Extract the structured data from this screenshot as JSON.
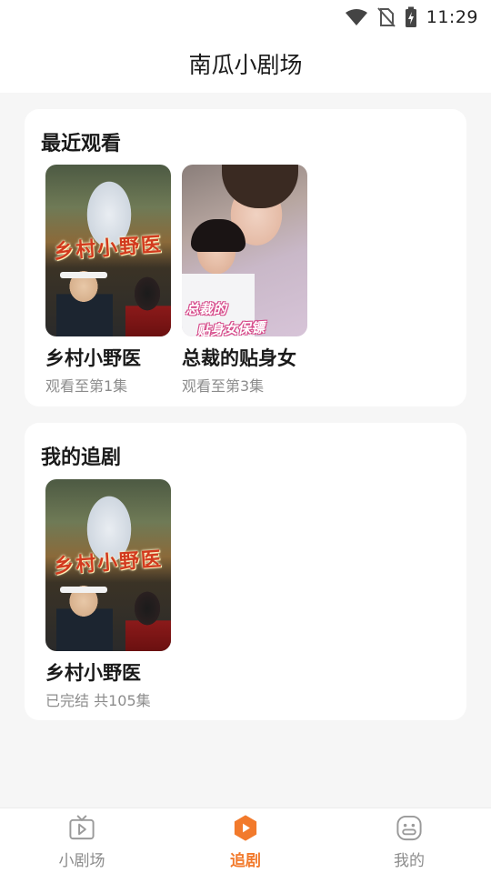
{
  "status_bar": {
    "time": "11:29",
    "icons": [
      "wifi-icon",
      "no-sim-icon",
      "battery-charging-icon"
    ]
  },
  "header": {
    "title": "南瓜小剧场"
  },
  "recent": {
    "title": "最近观看",
    "items": [
      {
        "name": "乡村小野医",
        "progress": "观看至第1集",
        "poster_text": "乡村小野医"
      },
      {
        "name": "总裁的贴身女",
        "progress": "观看至第3集",
        "poster_text_line1": "总裁的",
        "poster_text_line2": "贴身女保镖"
      }
    ]
  },
  "following": {
    "title": "我的追剧",
    "items": [
      {
        "name": "乡村小野医",
        "status": "已完结 共105集",
        "poster_text": "乡村小野医"
      }
    ]
  },
  "tab_bar": {
    "tabs": [
      {
        "label": "小剧场",
        "icon": "tv-icon",
        "active": false
      },
      {
        "label": "追剧",
        "icon": "play-hexagon-icon",
        "active": true
      },
      {
        "label": "我的",
        "icon": "face-icon",
        "active": false
      }
    ],
    "active_color": "#f27a2c",
    "inactive_color": "#8c8c8c"
  }
}
